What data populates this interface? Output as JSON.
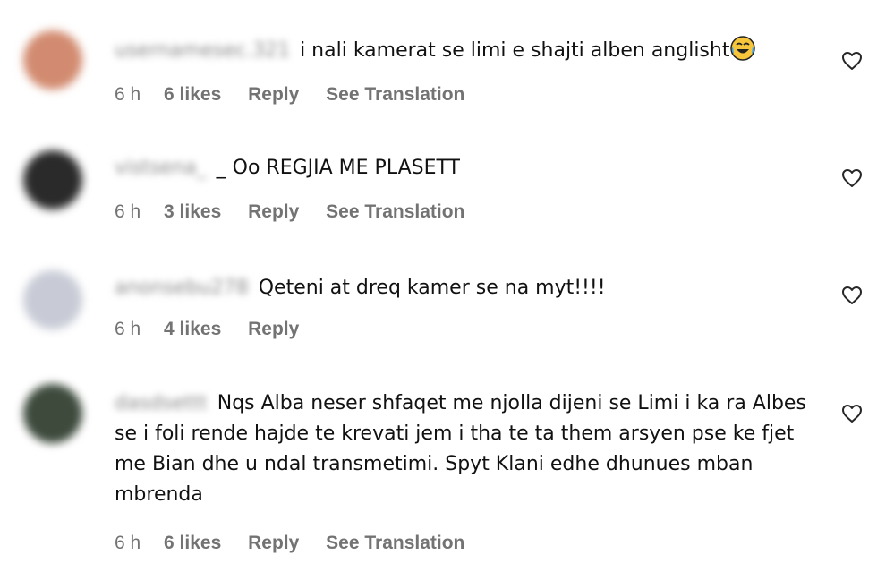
{
  "colors": {
    "background": "#ffffff",
    "meta_text": "#737373",
    "comment_text": "#111111"
  },
  "comments": [
    {
      "username": "usernamesec.321",
      "text": "i nali kamerat se limi e shajti alben anglisht",
      "emoji": "tears-of-joy-emoji",
      "time": "6 h",
      "likes": "6 likes",
      "reply": "Reply",
      "translate": "See Translation",
      "avatar_color": "#d28b70"
    },
    {
      "username": "vistsena_",
      "text": "_ Oo REGJIA ME PLASETT",
      "time": "6 h",
      "likes": "3 likes",
      "reply": "Reply",
      "translate": "See Translation",
      "avatar_color": "#2a2a2a"
    },
    {
      "username": "anonsebu278",
      "text": "Qeteni at dreq kamer se na myt!!!!",
      "time": "6 h",
      "likes": "4 likes",
      "reply": "Reply",
      "avatar_color": "#c8cbd6"
    },
    {
      "username": "dasdsettt",
      "text": "Nqs Alba neser shfaqet me njolla dijeni se Limi i ka ra Albes se i foli rende hajde te krevati jem i tha te ta them arsyen pse ke fjet me Bian dhe u ndal transmetimi. Spyt Klani edhe dhunues mban mbrenda",
      "time": "6 h",
      "likes": "6 likes",
      "reply": "Reply",
      "translate": "See Translation",
      "avatar_color": "#3d4a3c"
    }
  ]
}
